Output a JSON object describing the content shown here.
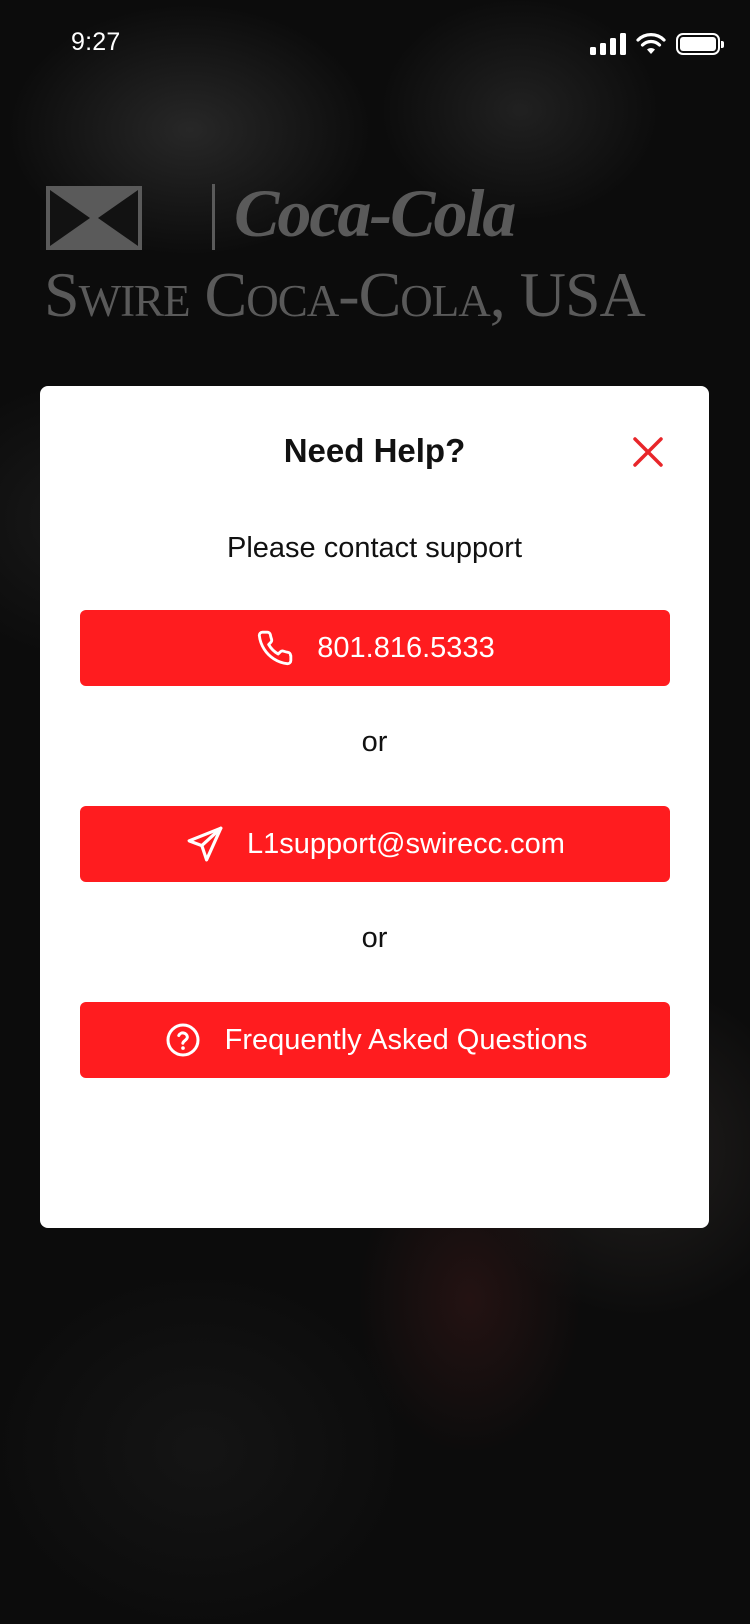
{
  "status_bar": {
    "time": "9:27"
  },
  "logo": {
    "script": "Coca-Cola",
    "text": "Swire Coca-Cola, USA"
  },
  "modal": {
    "title": "Need Help?",
    "subtitle": "Please contact support",
    "phone_label": "801.816.5333",
    "or_1": "or",
    "email_label": "L1support@swirecc.com",
    "or_2": "or",
    "faq_label": "Frequently Asked Questions"
  },
  "colors": {
    "accent": "#ff1c1f",
    "close": "#e8262a"
  }
}
